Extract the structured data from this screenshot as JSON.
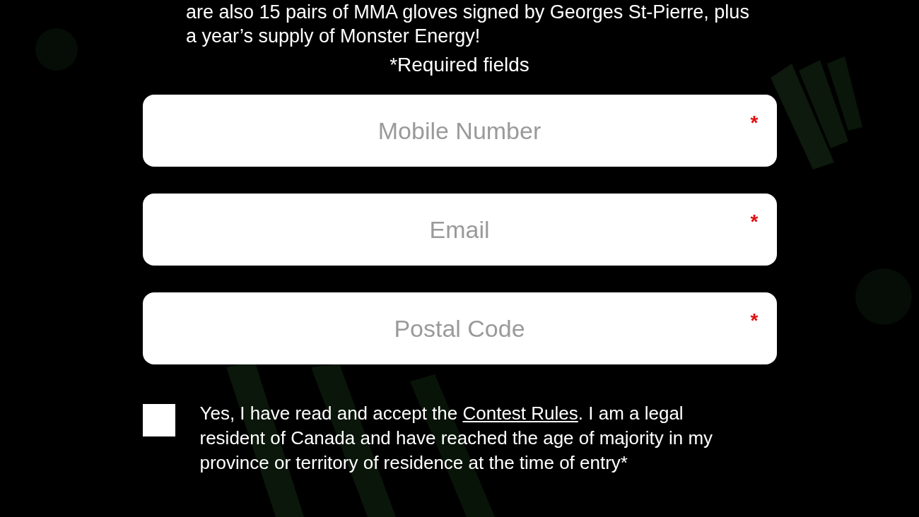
{
  "intro": {
    "text": "are also 15 pairs of MMA gloves signed by Georges St-Pierre, plus a year’s supply of Monster Energy!"
  },
  "required_note": "*Required fields",
  "fields": [
    {
      "placeholder": "Mobile Number",
      "required_mark": "*"
    },
    {
      "placeholder": "Email",
      "required_mark": "*"
    },
    {
      "placeholder": "Postal Code",
      "required_mark": "*"
    }
  ],
  "consent": {
    "checked": false,
    "text_before": "Yes, I have read and accept the ",
    "link": "Contest Rules",
    "text_after": ". I am a legal resident of Canada and have reached the age of majority in my province or territory of residence at the time of entry*"
  }
}
